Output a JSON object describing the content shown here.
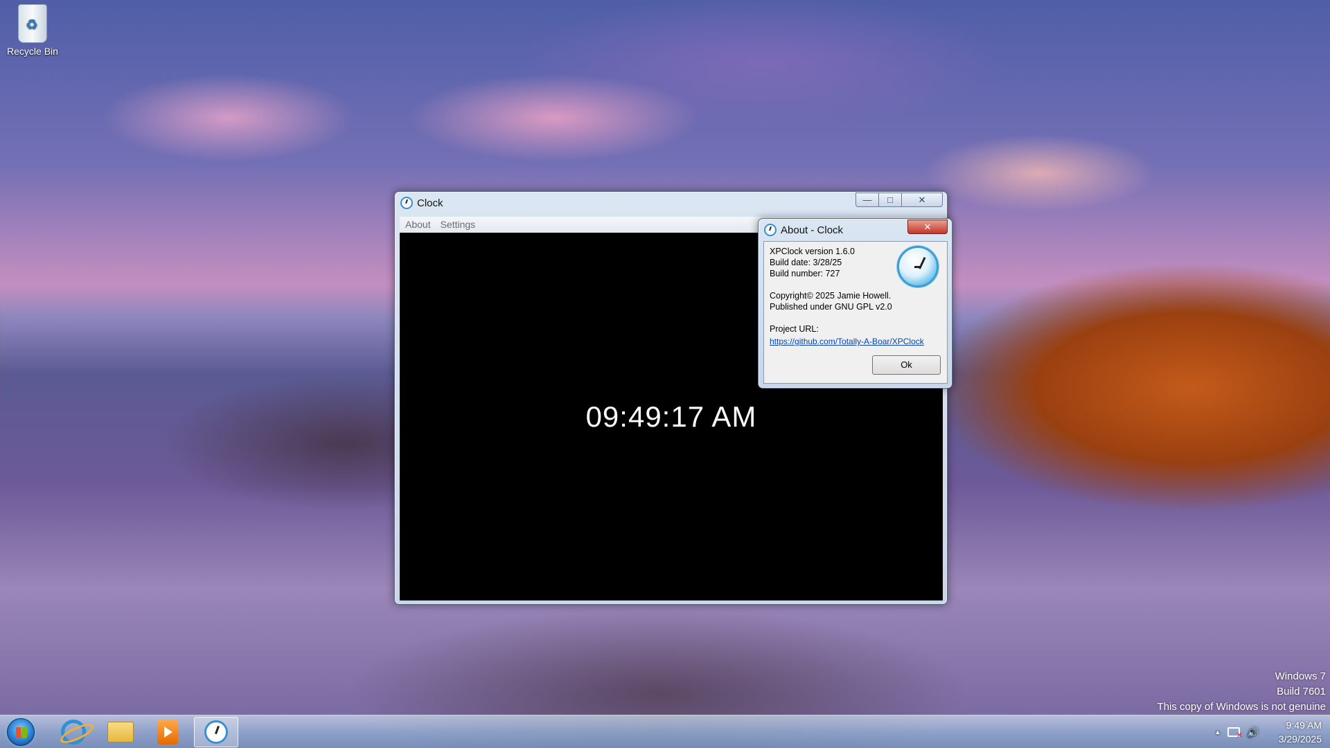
{
  "desktop": {
    "icons": [
      {
        "label": "Recycle Bin",
        "icon": "recycle-bin-icon"
      }
    ],
    "watermark": {
      "line1": "Windows 7",
      "line2": "Build 7601",
      "line3": "This copy of Windows is not genuine"
    }
  },
  "clock_window": {
    "title": "Clock",
    "menu": [
      "About",
      "Settings"
    ],
    "time_display": "09:49:17 AM",
    "caption_buttons": {
      "minimize": "—",
      "maximize": "□",
      "close": "✕"
    }
  },
  "about_dialog": {
    "title": "About - Clock",
    "version": "XPClock version 1.6.0",
    "build_date": "Build date: 3/28/25",
    "build_number": "Build number: 727",
    "copyright": "Copyright© 2025 Jamie Howell.",
    "license": "Published under GNU GPL v2.0",
    "project_url_label": "Project URL:",
    "project_url": "https://github.com/Totally-A-Boar/XPClock",
    "ok_label": "Ok",
    "close": "✕"
  },
  "taskbar": {
    "items": [
      "start-button",
      "internet-explorer-icon",
      "folder-icon",
      "media-player-icon",
      "clock-app-icon"
    ],
    "tray": {
      "time": "9:49 AM",
      "date": "3/29/2025",
      "up_arrow": "▲",
      "speaker": "🔊"
    }
  },
  "colors": {
    "accent": "#3a8fd0",
    "close_red": "#c5362a",
    "link": "#0645ad"
  }
}
